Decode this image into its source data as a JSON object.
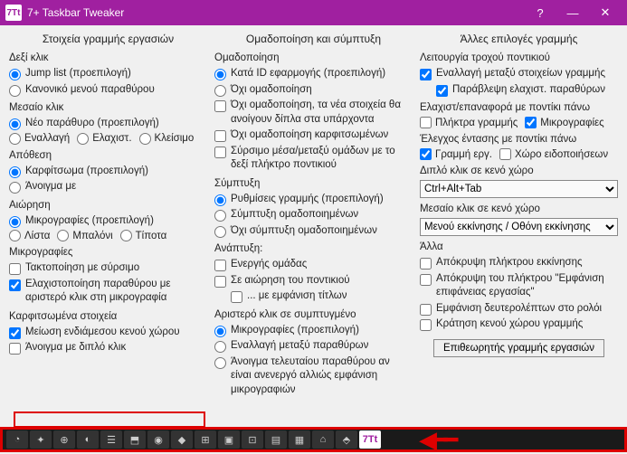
{
  "titlebar": {
    "app_icon": "7Tt",
    "title": "7+ Taskbar Tweaker"
  },
  "col1": {
    "header": "Στοιχεία γραμμής εργασιών",
    "right_click": {
      "title": "Δεξί κλικ",
      "jump": "Jump list (προεπιλογή)",
      "menu": "Κανονικό μενού παραθύρου"
    },
    "middle_click": {
      "title": "Μεσαίο κλικ",
      "new": "Νέο παράθυρο (προεπιλογή)",
      "switch": "Εναλλαγή",
      "min": "Ελαχιστ.",
      "close": "Κλείσιμο"
    },
    "drop": {
      "title": "Απόθεση",
      "pin": "Καρφίτσωμα (προεπιλογή)",
      "open": "Άνοιγμα με"
    },
    "hover": {
      "title": "Αιώρηση",
      "thumb": "Μικρογραφίες (προεπιλογή)",
      "list": "Λίστα",
      "balloon": "Μπαλόνι",
      "nothing": "Τίποτα"
    },
    "thumbs": {
      "title": "Μικρογραφίες",
      "drag": "Τακτοποίηση με σύρσιμο",
      "leftmin": "Ελαχιστοποίηση παραθύρου με αριστερό κλικ στη μικρογραφία"
    },
    "pinned": {
      "title": "Καρφιτσωμένα στοιχεία",
      "reduce": "Μείωση ενδιάμεσου κενού χώρου",
      "open_dbl": "Άνοιγμα με διπλό κλικ"
    }
  },
  "col2": {
    "header": "Ομαδοποίηση και σύμπτυξη",
    "grouping": {
      "title": "Ομαδοποίηση",
      "byid": "Κατά ID εφαρμογής (προεπιλογή)",
      "none": "Όχι ομαδοποίηση",
      "nonew": "Όχι ομαδοποίηση, τα νέα στοιχεία θα ανοίγουν δίπλα στα υπάρχοντα",
      "nopin": "Όχι ομαδοποίηση καρφιτσωμένων",
      "drag": "Σύρσιμο μέσα/μεταξύ ομάδων με το δεξί πλήκτρο ποντικιού"
    },
    "combine": {
      "title": "Σύμπτυξη",
      "def": "Ρυθμίσεις γραμμής (προεπιλογή)",
      "comb": "Σύμπτυξη ομαδοποιημένων",
      "nocomb": "Όχι σύμπτυξη ομαδοποιημένων"
    },
    "decomb": {
      "title": "Ανάπτυξη:",
      "active": "Ενεργής ομάδας",
      "hover": "Σε αιώρηση του ποντικιού",
      "titles": "... με εμφάνιση τίτλων"
    },
    "leftcomb": {
      "title": "Αριστερό κλικ σε συμπτυγμένο",
      "thumbs": "Μικρογραφίες (προεπιλογή)",
      "cycle": "Εναλλαγή μεταξύ παραθύρων",
      "last": "Άνοιγμα τελευταίου παραθύρου αν είναι ανενεργό αλλιώς εμφάνιση μικρογραφιών"
    }
  },
  "col3": {
    "header": "Άλλες επιλογές γραμμής",
    "wheel": {
      "title": "Λειτουργία τροχού ποντικιού",
      "cycle": "Εναλλαγή μεταξύ στοιχείων γραμμής",
      "skipmin": "Παράβλεψη ελαχιστ. παραθύρων"
    },
    "minrest": {
      "title": "Ελαχιστ/επαναφορά με ποντίκι πάνω",
      "keys": "Πλήκτρα γραμμής",
      "thumbs": "Μικρογραφίες"
    },
    "volume": {
      "title": "Έλεγχος έντασης με ποντίκι πάνω",
      "task": "Γραμμή εργ.",
      "notif": "Χώρο ειδοποιήσεων"
    },
    "dbl": {
      "title": "Διπλό κλικ σε κενό χώρο",
      "value": "Ctrl+Alt+Tab"
    },
    "mid": {
      "title": "Μεσαίο κλικ σε κενό χώρο",
      "value": "Μενού εκκίνησης / Οθόνη εκκίνησης"
    },
    "other": {
      "title": "Άλλα",
      "hidestart": "Απόκρυψη πλήκτρου εκκίνησης",
      "hideshow": "Απόκρυψη του πλήκτρου \"Εμφάνιση επιφάνειας εργασίας\"",
      "seconds": "Εμφάνιση δευτερολέπτων στο ρολόι",
      "reserve": "Κράτηση κενού χώρου γραμμής"
    },
    "inspector": "Επιθεωρητής γραμμής εργασιών"
  },
  "taskbar_icons": [
    "◔",
    "✦",
    "⊕",
    "◐",
    "☰",
    "⬒",
    "◉",
    "◆",
    "⊞",
    "▣",
    "⊡",
    "▤",
    "▦",
    "⌂",
    "⬘"
  ],
  "taskbar_app": "7Tt"
}
